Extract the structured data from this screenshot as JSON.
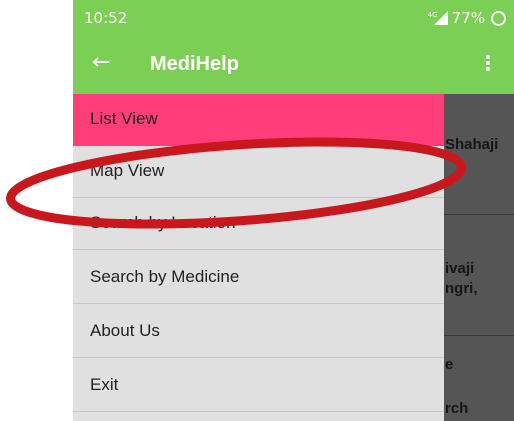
{
  "status_bar": {
    "time": "10:52",
    "network": "4G",
    "battery": "77%"
  },
  "app_bar": {
    "title": "MediHelp"
  },
  "drawer": {
    "items": [
      {
        "label": "List View",
        "active": true
      },
      {
        "label": "Map View",
        "active": false
      },
      {
        "label": "Search by Location",
        "active": false
      },
      {
        "label": "Search by Medicine",
        "active": false
      },
      {
        "label": "About Us",
        "active": false
      },
      {
        "label": "Exit",
        "active": false
      }
    ]
  },
  "background_content": {
    "fragments": [
      "Shahaji",
      "ivaji",
      "ngri,",
      "e",
      "rch"
    ]
  },
  "colors": {
    "app_bar": "#7ccf55",
    "active_item": "#ff3d7a",
    "drawer_bg": "#e0e0e0",
    "annotation": "#c8171d"
  }
}
